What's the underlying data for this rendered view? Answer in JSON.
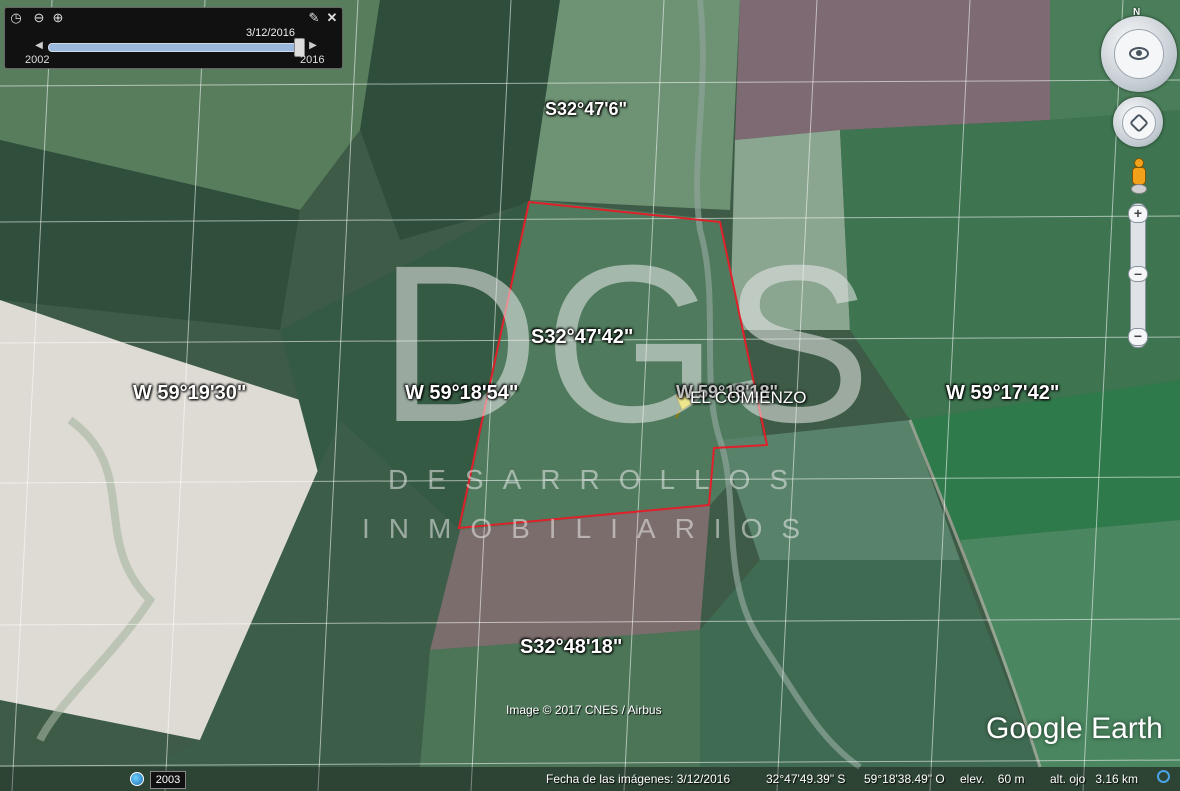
{
  "map": {
    "latitude_labels": [
      "S32°47'6\"",
      "S32°47'42\"",
      "S32°48'18\""
    ],
    "longitude_labels": [
      "W 59°19'30\"",
      "W 59°18'54\"",
      "W 59°18'18\"",
      "W 59°17'42\""
    ],
    "placemark_label": "EL COMIENZO",
    "property_outline_color": "#e0202a",
    "placemark_color": "#f2e51c"
  },
  "watermark": {
    "logo": "DGS",
    "line1": "DESARROLLOS",
    "line2": "INMOBILIARIOS"
  },
  "time_slider": {
    "current_date": "3/12/2016",
    "start_year": "2002",
    "end_year": "2016",
    "position_fraction": 1.0,
    "icons": [
      "clock-icon",
      "zoom-out-icon",
      "zoom-in-icon",
      "wrench-icon",
      "close-icon"
    ]
  },
  "navigation": {
    "north_label": "N"
  },
  "footer": {
    "copyright": "Image © 2017 CNES / Airbus",
    "brand_google": "Google",
    "brand_earth": "Earth",
    "historical_year": "2003",
    "imagery_date": "Fecha de las imágenes: 3/12/2016",
    "latitude": "32°47'49.39\" S",
    "longitude": "59°18'38.49\" O",
    "elevation": "elev.    60 m",
    "eye_altitude": "alt. ojo   3.16 km"
  }
}
